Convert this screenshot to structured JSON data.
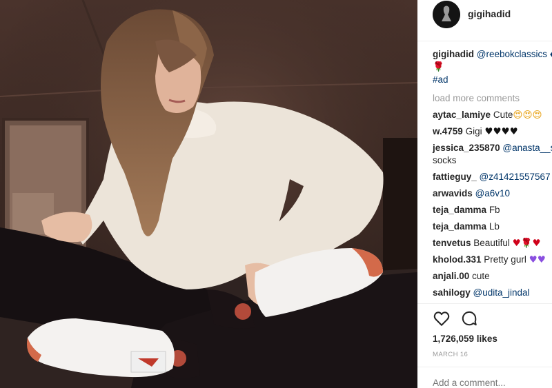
{
  "header": {
    "username": "gigihadid"
  },
  "caption": {
    "username": "gigihadid",
    "mention": "@reebokclassics",
    "trail": " ♦",
    "emoji_line": "🌹",
    "hashtag": "#ad"
  },
  "load_more": "load more comments",
  "comments": [
    {
      "username": "aytac_lamiye",
      "text": "Cute",
      "emoji": "😍😍😍"
    },
    {
      "username": "w.4759",
      "text": "Gigi",
      "emoji": "♥♥♥♥"
    },
    {
      "username": "jessica_235870",
      "mention": "@anasta__si",
      "text_line2": "socks"
    },
    {
      "username": "fattieguy_",
      "mention": "@z41421557567"
    },
    {
      "username": "arwavids",
      "mention": "@a6v10"
    },
    {
      "username": "teja_damma",
      "text": "Fb"
    },
    {
      "username": "teja_damma",
      "text": "Lb"
    },
    {
      "username": "tenvetus",
      "text": "Beautiful",
      "emoji": "♥🌹♥"
    },
    {
      "username": "kholod.331",
      "text": "Pretty gurl",
      "emoji": "♥♥"
    },
    {
      "username": "anjali.00",
      "text": "cute"
    },
    {
      "username": "sahilogy",
      "mention": "@udita_jindal"
    }
  ],
  "likes": "1,726,059 likes",
  "date": "MARCH 16",
  "add_comment_placeholder": "Add a comment...",
  "icons": {
    "like": "heart-outline-icon",
    "comment": "speech-bubble-icon"
  },
  "colors": {
    "link": "#003569",
    "muted": "#999999",
    "text": "#262626",
    "heart": "#d0021b"
  }
}
